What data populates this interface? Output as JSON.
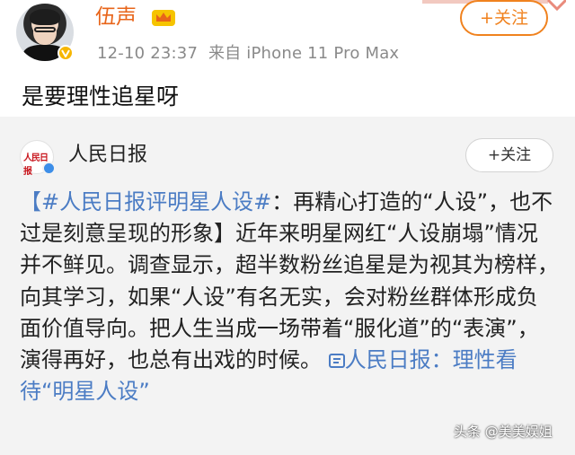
{
  "post": {
    "user_name": "伍声",
    "timestamp": "12-10 23:37",
    "source": "来自 iPhone 11 Pro Max",
    "follow_label": "+关注",
    "text": "是要理性追星呀"
  },
  "repost": {
    "user_name": "人民日报",
    "logo_text": "人民日报",
    "follow_label": "+关注",
    "hashtag": "【#人民日报评明星人设#",
    "body": "：再精心打造的“人设”，也不过是刻意呈现的形象】近年来明星网红“人设崩塌”情况并不鲜见。调查显示，超半数粉丝追星是为视其为榜样，向其学习，如果“人设”有名无实，会对粉丝群体形成负面价值导向。把人生当成一场带着“服化道”的“表演”，演得再好，也总有出戏的时候。",
    "link_text": "人民日报：理性看待“明星人设”"
  },
  "watermark": "头条 @美美娱姐",
  "colors": {
    "username_orange": "#e8651a",
    "follow_orange": "#f0821e",
    "link_blue": "#4b7cc4",
    "repost_bg": "#f3f3f3",
    "vip_gold": "#f6b600"
  },
  "icons": [
    "vip-badge-icon",
    "crown-icon",
    "verified-badge-icon",
    "link-icon"
  ]
}
